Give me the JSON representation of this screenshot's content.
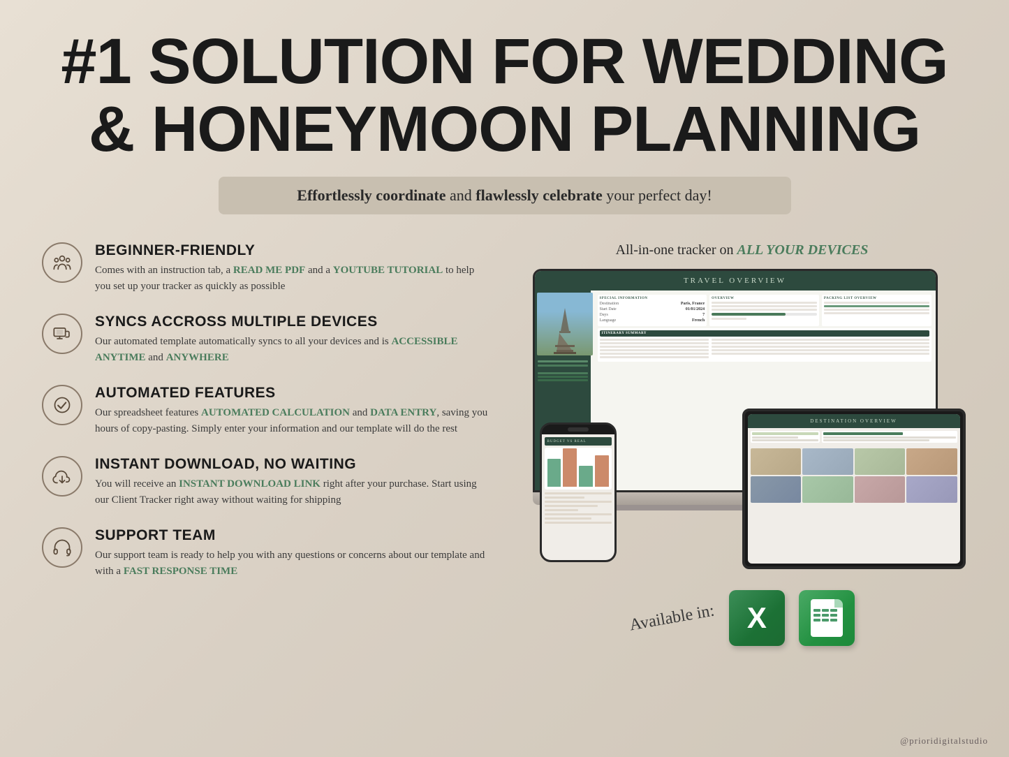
{
  "title": "#1 SOLUTION FOR WEDDING & HONEYMOON PLANNING",
  "title_line1": "#1 SOLUTION FOR WEDDING",
  "title_line2": "& HONEYMOON PLANNING",
  "subtitle": {
    "part1": "Effortlessly coordinate",
    "part2": " and ",
    "part3": "flawlessly celebrate",
    "part4": " your perfect day!"
  },
  "right_header": {
    "text": "All-in-one tracker on ",
    "highlight": "ALL YOUR DEVICES"
  },
  "features": [
    {
      "id": "beginner",
      "title": "BEGINNER-FRIENDLY",
      "description_parts": [
        {
          "text": "Comes with an instruction tab, a ",
          "type": "normal"
        },
        {
          "text": "READ ME PDF",
          "type": "green"
        },
        {
          "text": " and a ",
          "type": "normal"
        },
        {
          "text": "YOUTUBE TUTORIAL",
          "type": "green"
        },
        {
          "text": " to help you set up your tracker as quickly as possible",
          "type": "normal"
        }
      ]
    },
    {
      "id": "syncs",
      "title": "SYNCS ACCROSS MULTIPLE DEVICES",
      "description_parts": [
        {
          "text": "Our automated template automatically syncs to all your devices and is ",
          "type": "normal"
        },
        {
          "text": "ACCESSIBLE ANYTIME",
          "type": "green"
        },
        {
          "text": " and ",
          "type": "normal"
        },
        {
          "text": "ANYWHERE",
          "type": "green"
        }
      ]
    },
    {
      "id": "automated",
      "title": "AUTOMATED FEATURES",
      "description_parts": [
        {
          "text": "Our spreadsheet features ",
          "type": "normal"
        },
        {
          "text": "AUTOMATED CALCULATION",
          "type": "green"
        },
        {
          "text": " and ",
          "type": "normal"
        },
        {
          "text": "DATA ENTRY",
          "type": "green"
        },
        {
          "text": ", saving you hours of copy-pasting. Simply enter your information and our template will do the rest",
          "type": "normal"
        }
      ]
    },
    {
      "id": "download",
      "title": "INSTANT DOWNLOAD, NO WAITING",
      "description_parts": [
        {
          "text": "You will receive an ",
          "type": "normal"
        },
        {
          "text": "INSTANT DOWNLOAD LINK",
          "type": "green"
        },
        {
          "text": " right after your purchase. Start using our Client Tracker right away without waiting for shipping",
          "type": "normal"
        }
      ]
    },
    {
      "id": "support",
      "title": "SUPPORT TEAM",
      "description_parts": [
        {
          "text": "Our support team is ready to help you with any questions or concerns about our template and with a ",
          "type": "normal"
        },
        {
          "text": "FAST RESPONSE TIME",
          "type": "green"
        }
      ]
    }
  ],
  "available_in": "Available in:",
  "watermark": "@prioridigitalstudio",
  "screen_title": "TRAVEL OVERVIEW",
  "screen_title2": "DESTINATION OVERVIEW",
  "excel_label": "X",
  "green_color": "#4a7c5c"
}
